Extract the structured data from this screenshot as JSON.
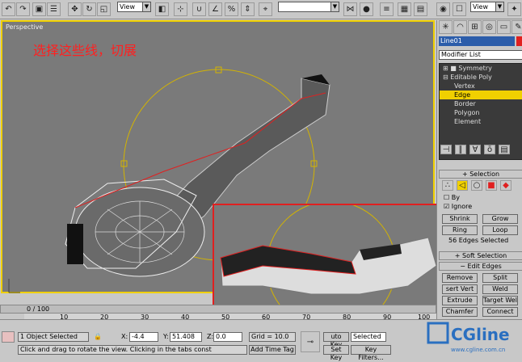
{
  "toolbar": {
    "ref_coord_label": "View",
    "selection_set_label": "",
    "view_dropdown_label": "View",
    "buttons": [
      "undo-icon",
      "redo-icon",
      "select-link-icon",
      "unlink-icon",
      "bind-space-warp-icon",
      "select-icon",
      "select-by-name-icon",
      "rect-region-icon",
      "move-icon",
      "rotate-icon",
      "scale-icon",
      "mirror-icon",
      "align-icon",
      "layer-icon",
      "curve-editor-icon",
      "schematic-icon",
      "material-editor-icon",
      "render-scene-icon",
      "quick-render-icon"
    ]
  },
  "viewport": {
    "label": "Perspective",
    "note": "选择这些线，切展"
  },
  "command_panel": {
    "object_name": "Line01",
    "modifier_list": "Modifier List",
    "stack": [
      {
        "label": "Symmetry",
        "selected": false
      },
      {
        "label": "Editable Poly",
        "selected": false
      },
      {
        "label": "Vertex",
        "selected": false
      },
      {
        "label": "Edge",
        "selected": true
      },
      {
        "label": "Border",
        "selected": false
      },
      {
        "label": "Polygon",
        "selected": false
      },
      {
        "label": "Element",
        "selected": false
      }
    ],
    "selection_title": "Selection",
    "by_label": "By",
    "ignore_label": "Ignore",
    "shrink": "Shrink",
    "grow": "Grow",
    "ring": "Ring",
    "loop": "Loop",
    "selected_count": "56 Edges Selected",
    "soft_selection": "Soft Selection",
    "edit_edges": "Edit Edges",
    "remove": "Remove",
    "split": "Split",
    "insert_vertex": "sert Vert",
    "weld": "Weld",
    "extrude": "Extrude",
    "target_weld": "Target Wel",
    "chamfer": "Chamfer",
    "connect": "Connect"
  },
  "timeline": {
    "frame": "0 / 100",
    "ticks": [
      "10",
      "20",
      "30",
      "40",
      "50",
      "60",
      "70",
      "80",
      "90",
      "100"
    ]
  },
  "status": {
    "selected": "1 Object Selected",
    "x_label": "X:",
    "x_value": "-4.4",
    "y_label": "Y:",
    "y_value": "51.408",
    "z_label": "Z:",
    "z_value": "0.0",
    "grid": "Grid = 10.0",
    "prompt": "Click and drag to rotate the view.  Clicking in the tabs const",
    "add_time_tag": "Add Time Tag",
    "auto_key": "uto Key",
    "set_key": "Set Key",
    "selected_dropdown": "Selected",
    "key_filters": "Key Filters..."
  },
  "watermark": {
    "brand": "CGline",
    "url": "www.cgline.com.cn"
  }
}
